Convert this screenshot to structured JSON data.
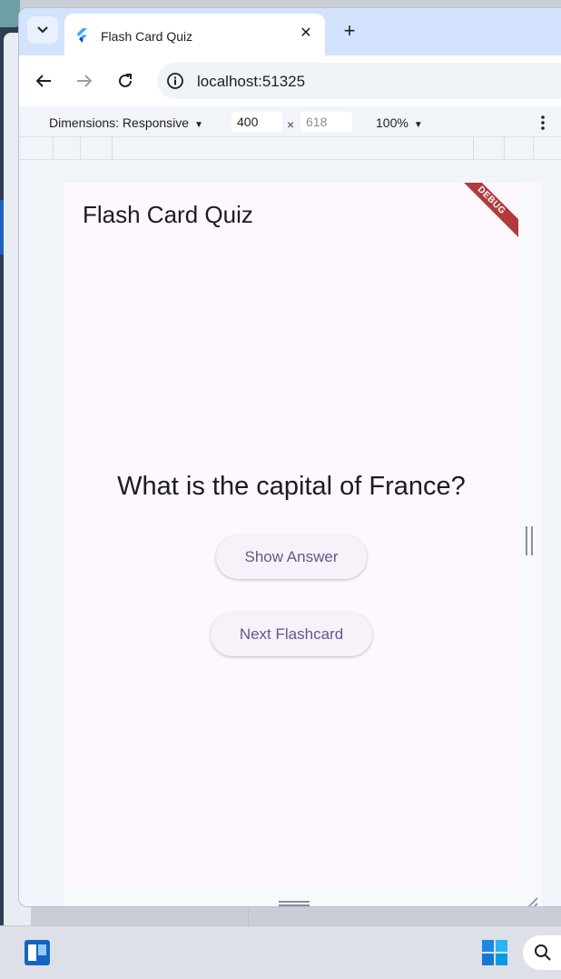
{
  "browser": {
    "tab_title": "Flash Card Quiz",
    "url": "localhost:51325",
    "icons": {
      "tab_menu": "chevron-down-icon",
      "favicon": "flutter-icon",
      "close_tab": "close-icon",
      "new_tab": "plus-icon",
      "back": "back-arrow-icon",
      "forward": "forward-arrow-icon",
      "reload": "reload-icon",
      "site_info": "info-icon"
    }
  },
  "devtools": {
    "dimensions_label": "Dimensions: Responsive",
    "width": "400",
    "separator": "×",
    "height": "618",
    "zoom": "100%"
  },
  "app": {
    "title": "Flash Card Quiz",
    "debug_banner": "DEBUG",
    "question": "What is the capital of France?",
    "show_answer_label": "Show Answer",
    "next_label": "Next Flashcard",
    "colors": {
      "background": "#fef7ff",
      "button_text": "#65558f",
      "button_bg": "#f7f2fa",
      "banner": "#b23a3a"
    }
  },
  "taskbar": {
    "icons": [
      "app-icon",
      "windows-start-icon",
      "search-icon"
    ]
  }
}
